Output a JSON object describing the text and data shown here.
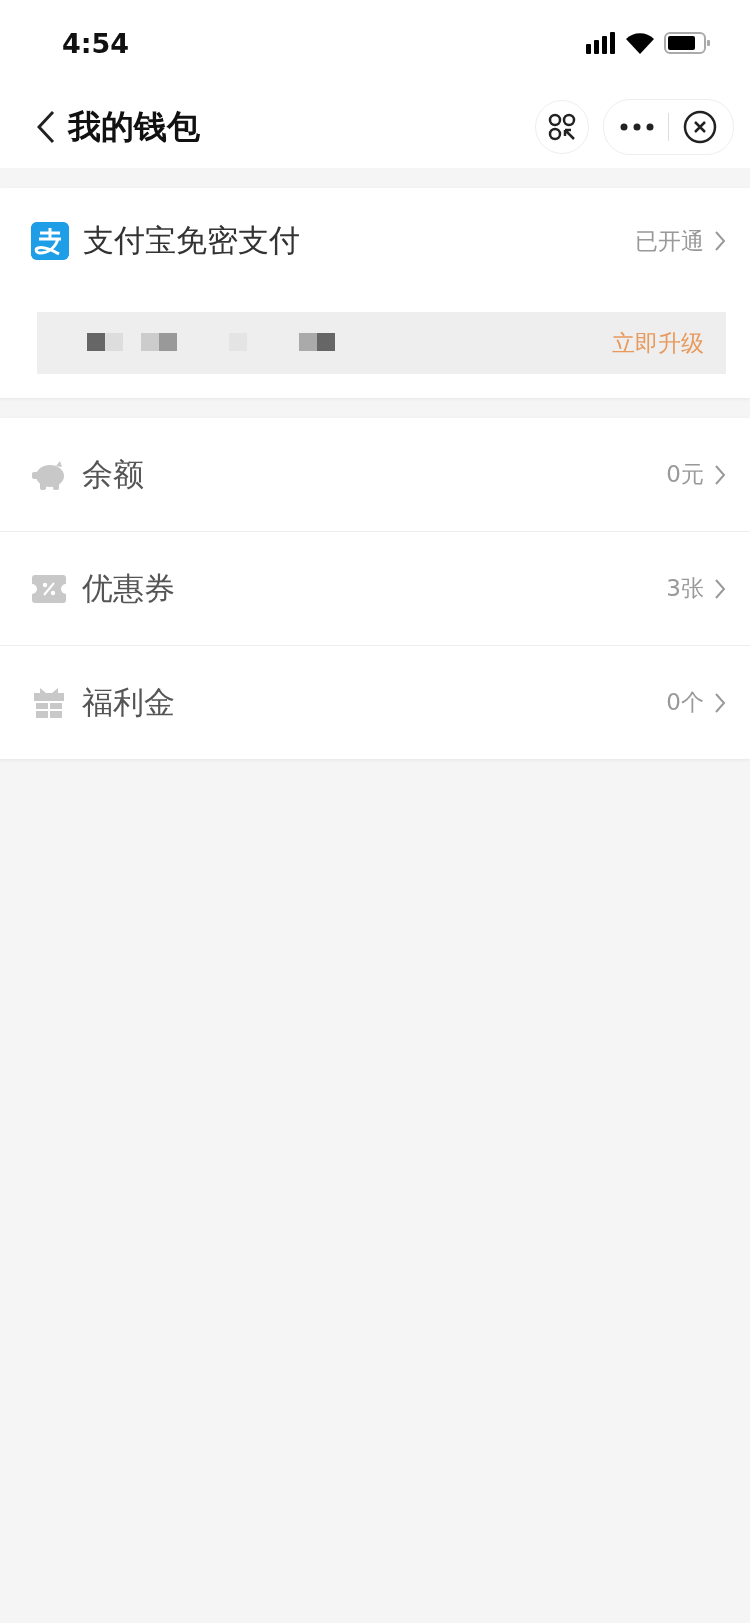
{
  "status_bar": {
    "time": "4:54"
  },
  "nav_bar": {
    "title": "我的钱包"
  },
  "payment_card": {
    "title": "支付宝免密支付",
    "status": "已开通",
    "upgrade_link": "立即升级"
  },
  "wallet_items": [
    {
      "kind": "piggy",
      "label": "余额",
      "value": "0元"
    },
    {
      "kind": "coupon",
      "label": "优惠券",
      "value": "3张"
    },
    {
      "kind": "gift",
      "label": "福利金",
      "value": "0个"
    }
  ]
}
